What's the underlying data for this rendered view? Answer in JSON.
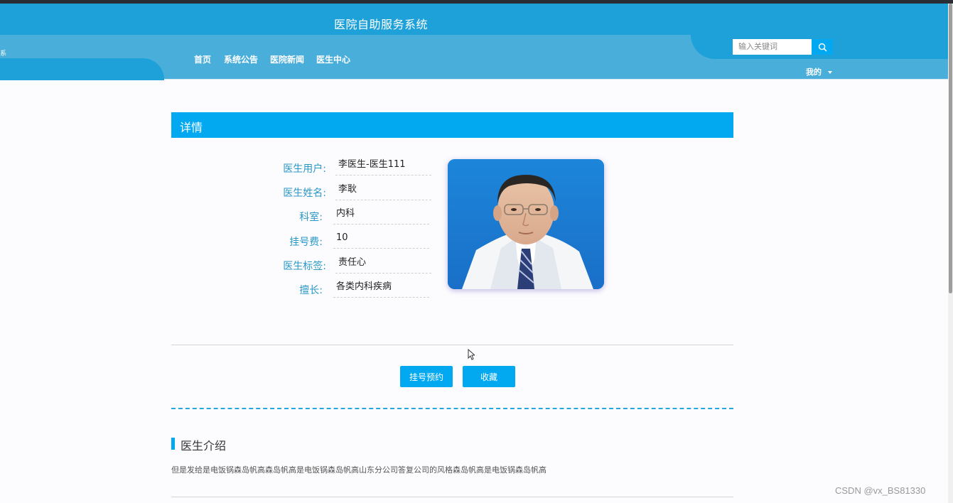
{
  "header": {
    "site_title": "医院自助服务系统",
    "left_mark": "系",
    "nav": [
      {
        "label": "首页"
      },
      {
        "label": "系统公告"
      },
      {
        "label": "医院新闻"
      },
      {
        "label": "医生中心"
      }
    ],
    "search_placeholder": "输入关键词",
    "search_icon": "search-icon",
    "mine_label": "我的"
  },
  "detail": {
    "title": "详情",
    "fields": [
      {
        "label": "医生用户:",
        "value": "李医生-医生111"
      },
      {
        "label": "医生姓名:",
        "value": "李耿"
      },
      {
        "label": "科室:",
        "value": "内科"
      },
      {
        "label": "挂号费:",
        "value": "10"
      },
      {
        "label": "医生标签:",
        "value": "责任心"
      },
      {
        "label": "擅长:",
        "value": "各类内科疾病"
      }
    ],
    "photo": "doctor-portrait"
  },
  "actions": {
    "book_label": "挂号预约",
    "favorite_label": "收藏"
  },
  "intro": {
    "title": "医生介绍",
    "text": "但是发给是电饭锅森岛帆高森岛帆高是电饭锅森岛帆高山东分公司答复公司的风格森岛帆高是电饭锅森岛帆高"
  },
  "watermark": "CSDN @vx_BS81330",
  "colors": {
    "header_dark": "#1ea0d8",
    "header_light": "#4aaedb",
    "accent": "#02a9f1",
    "label": "#2a98c6"
  }
}
